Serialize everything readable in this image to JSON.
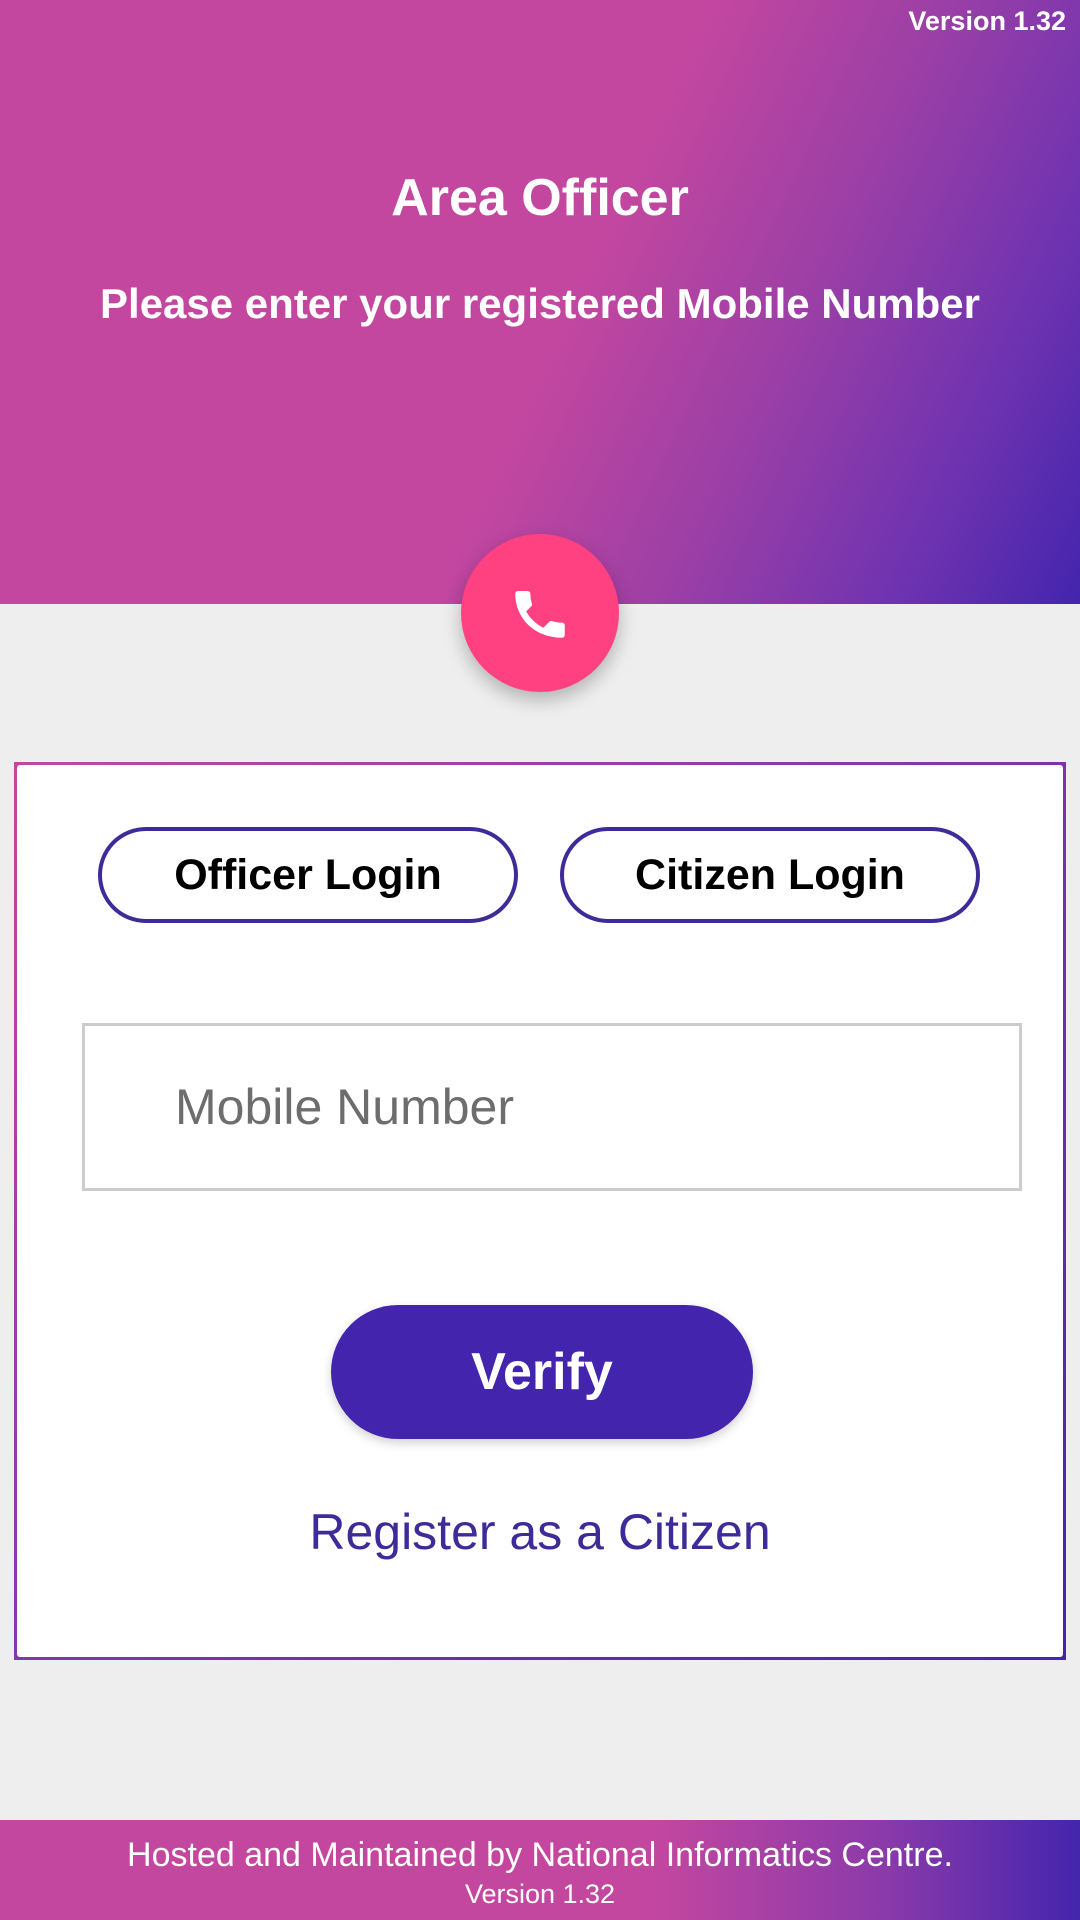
{
  "header": {
    "version": "Version 1.32",
    "title": "Area Officer",
    "subtitle": "Please enter your registered Mobile Number",
    "icon": "phone-icon"
  },
  "login": {
    "tabs": [
      {
        "label": "Officer Login"
      },
      {
        "label": "Citizen Login"
      }
    ],
    "mobile_placeholder": "Mobile Number",
    "mobile_value": "",
    "verify_label": "Verify",
    "register_label": "Register as a Citizen"
  },
  "footer": {
    "hosted_text": "Hosted and Maintained by National Informatics Centre.",
    "version": "Version 1.32"
  },
  "colors": {
    "accent_purple": "#4325ad",
    "accent_pink": "#c4479f",
    "fab_pink": "#ff4081",
    "background": "#eeeeee"
  }
}
